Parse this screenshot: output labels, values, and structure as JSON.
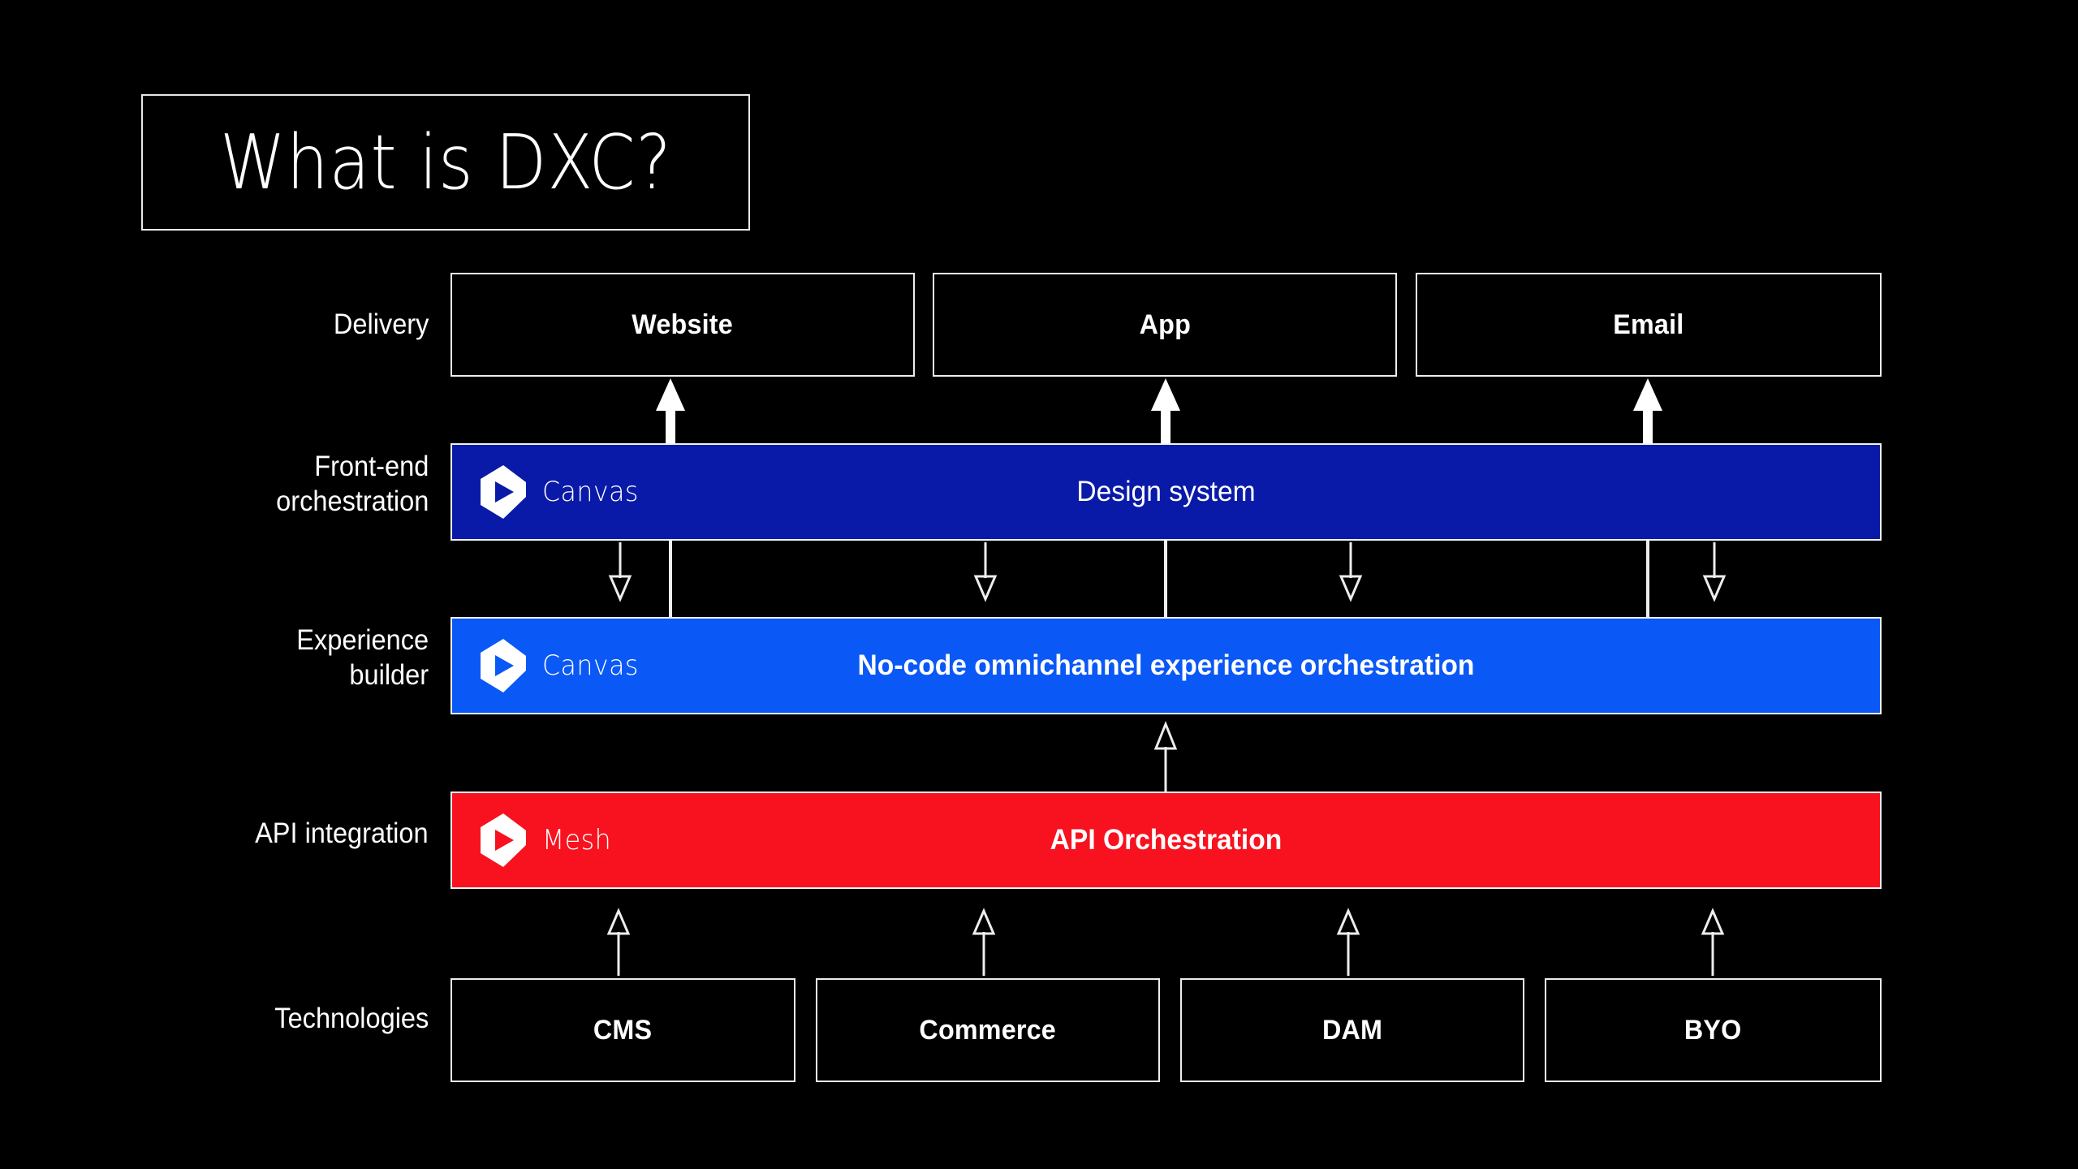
{
  "page": {
    "background": "#000000",
    "title": "What is DXC?"
  },
  "colors": {
    "background": "#000000",
    "stroke": "#ededed",
    "text": "#ffffff",
    "front_end_band": "#0a1aa8",
    "experience_band": "#0a58f5",
    "api_band": "#f8121f"
  },
  "rows": [
    {
      "id": "delivery",
      "label": "Delivery",
      "items": [
        {
          "label": "Website"
        },
        {
          "label": "App"
        },
        {
          "label": "Email"
        }
      ]
    },
    {
      "id": "front-end-orchestration",
      "label": "Front-end\norchestration",
      "brand": "Canvas",
      "brand_icon": "canvas-play-hex-logo",
      "band_label": "Design system",
      "band_color": "#0a1aa8"
    },
    {
      "id": "experience-builder",
      "label": "Experience\nbuilder",
      "brand": "Canvas",
      "brand_icon": "canvas-play-hex-logo",
      "band_label": "No-code omnichannel experience orchestration",
      "band_color": "#0a58f5"
    },
    {
      "id": "api-integration",
      "label": "API integration",
      "brand": "Mesh",
      "brand_icon": "mesh-play-hex-logo",
      "band_label": "API Orchestration",
      "band_color": "#f8121f"
    },
    {
      "id": "technologies",
      "label": "Technologies",
      "items": [
        {
          "label": "CMS"
        },
        {
          "label": "Commerce"
        },
        {
          "label": "DAM"
        },
        {
          "label": "BYO"
        }
      ]
    }
  ]
}
